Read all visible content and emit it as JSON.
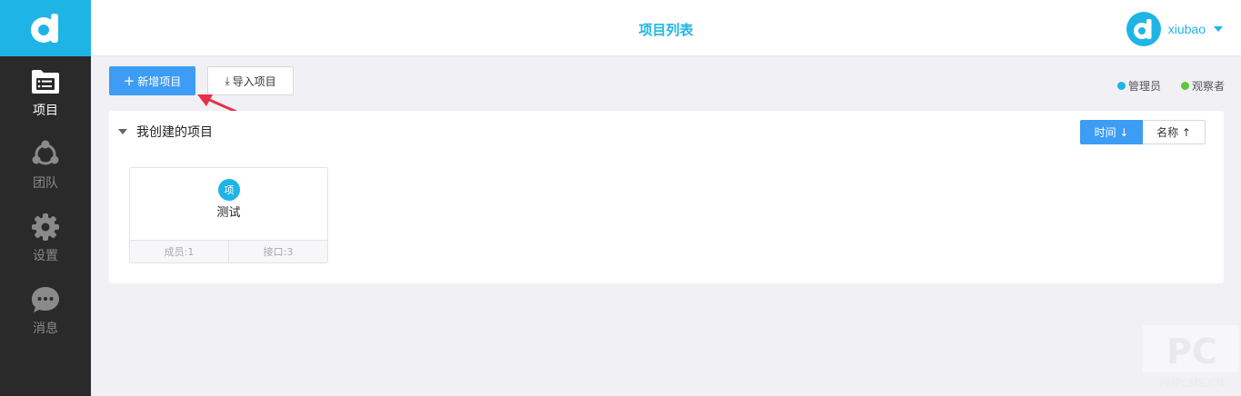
{
  "header": {
    "title": "项目列表"
  },
  "user": {
    "name": "xiubao"
  },
  "sidebar": {
    "items": [
      {
        "label": "项目",
        "icon": "folder-list-icon",
        "active": true
      },
      {
        "label": "团队",
        "icon": "team-icon",
        "active": false
      },
      {
        "label": "设置",
        "icon": "gear-icon",
        "active": false
      },
      {
        "label": "消息",
        "icon": "chat-bubble-icon",
        "active": false
      }
    ]
  },
  "toolbar": {
    "new_label": "新增项目",
    "import_label": "导入项目"
  },
  "legend": [
    {
      "label": "管理员",
      "color": "#1eb5e6"
    },
    {
      "label": "观察者",
      "color": "#5cc73c"
    }
  ],
  "section": {
    "title": "我创建的项目"
  },
  "sort": {
    "time_label": "时间 ↓",
    "name_label": "名称 ↑",
    "active": "time"
  },
  "projects": [
    {
      "badge": "项",
      "name": "测试",
      "members": "成员:1",
      "apis": "接口:3"
    }
  ],
  "watermark": {
    "text": "PHPCMS.CN"
  },
  "colors": {
    "accent": "#1eb5e6",
    "primary_button": "#3d9df5",
    "sidebar_bg": "#2a2a2a",
    "arrow": "#e8304a"
  }
}
